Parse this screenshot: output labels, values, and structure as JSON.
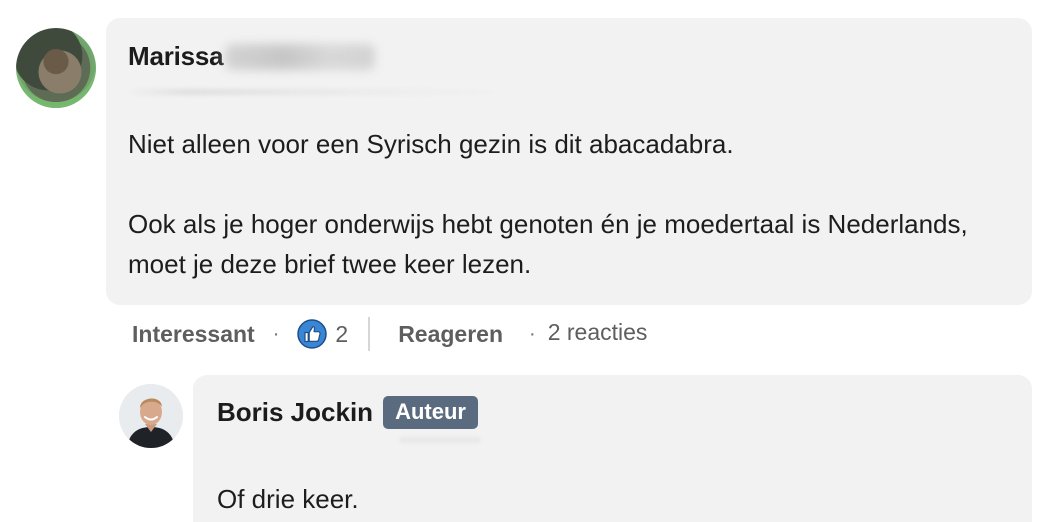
{
  "comment": {
    "author_first_name": "Marissa",
    "paragraphs": [
      "Niet alleen voor een Syrisch gezin is dit abacadabra.",
      "Ook als je hoger onderwijs hebt genoten én je moedertaal is Nederlands, moet je deze brief twee keer lezen."
    ]
  },
  "actions": {
    "interesting_label": "Interessant",
    "separator": "·",
    "like_count": "2",
    "reply_label": "Reageren",
    "reactions_label": "2 reacties",
    "like_icon": "thumbs-up-icon",
    "like_icon_color": "#3a86d6"
  },
  "reply": {
    "author_name": "Boris Jockin",
    "badge_label": "Auteur",
    "badge_color": "#5b6b7f",
    "text": "Of drie keer."
  },
  "colors": {
    "bubble_background": "#f2f2f2",
    "text": "#1d1d1d",
    "muted_text": "#5e5e5e"
  }
}
